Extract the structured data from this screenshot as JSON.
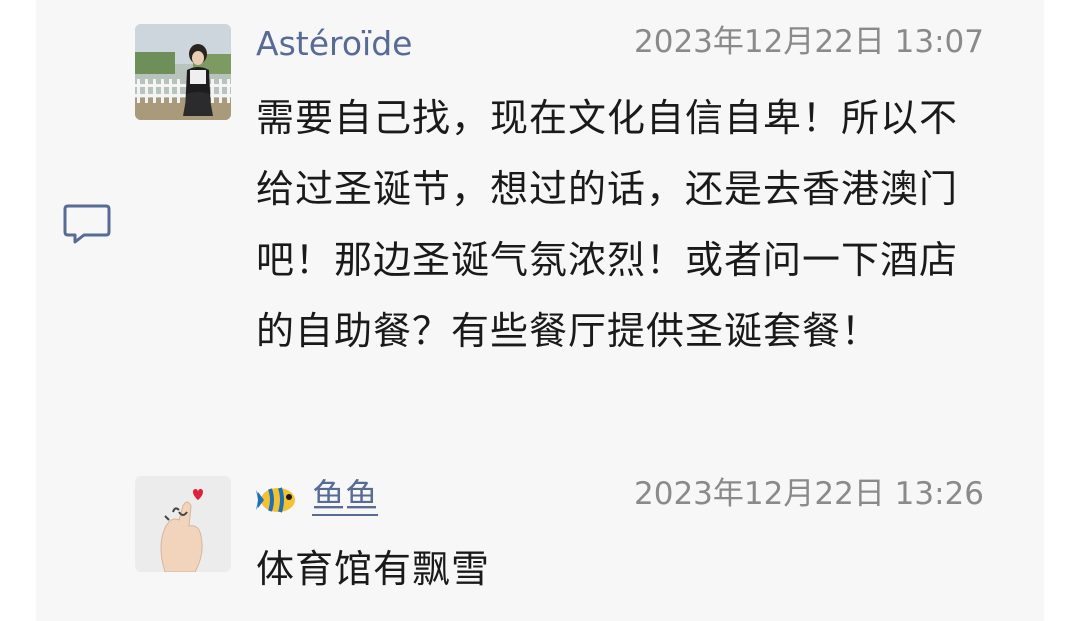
{
  "comments": [
    {
      "author": "Astéroïde",
      "timestamp": "2023年12月22日 13:07",
      "text": "需要自己找，现在文化自信自卑！所以不给过圣诞节，想过的话，还是去香港澳门吧！那边圣诞气氛浓烈！或者问一下酒店的自助餐？有些餐厅提供圣诞套餐！",
      "avatar": "photo-girl-fence"
    },
    {
      "author": "鱼鱼",
      "author_icon": "fish-icon",
      "timestamp": "2023年12月22日 13:26",
      "text": "体育馆有飘雪",
      "avatar": "photo-hand-heart"
    }
  ],
  "comment_icon": "comment-bubble-icon",
  "colors": {
    "author": "#576b95",
    "timestamp": "#8a8a8a",
    "text": "#1a1a1a",
    "panel": "#f7f7f7"
  }
}
